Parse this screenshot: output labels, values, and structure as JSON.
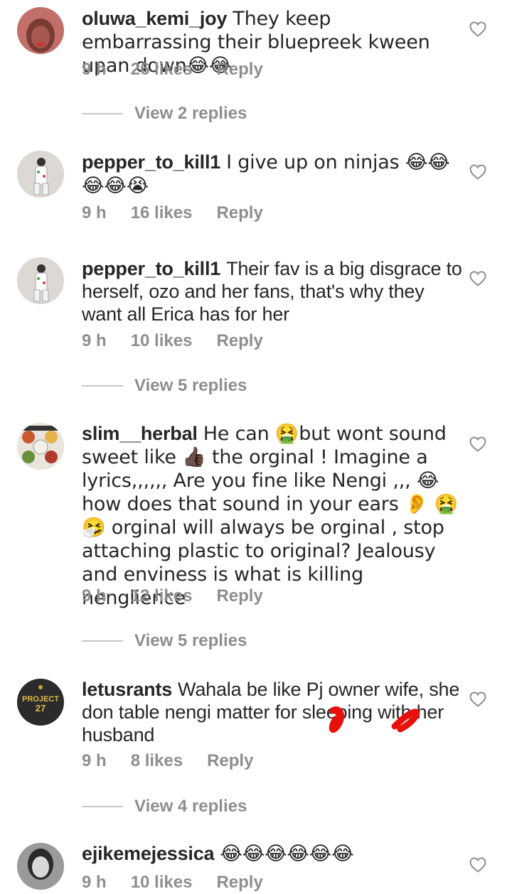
{
  "comments": [
    {
      "username": "oluwa_kemi_joy",
      "text": "They keep embarrassing their bluepreek kween upan down😂😂",
      "time": "9 h",
      "likes": "26 likes",
      "reply_label": "Reply",
      "view_replies": "View 2 replies",
      "avatar_color": "#b05a55"
    },
    {
      "username": "pepper_to_kill1",
      "text": "I give up on ninjas 😂😂😂😂😭",
      "time": "9 h",
      "likes": "16 likes",
      "reply_label": "Reply",
      "avatar_color": "#d8d4d0"
    },
    {
      "username": "pepper_to_kill1",
      "text": "Their fav is a big disgrace to herself, ozo and her fans, that's why they want all Erica has for her",
      "time": "9 h",
      "likes": "10 likes",
      "reply_label": "Reply",
      "view_replies": "View 5 replies",
      "avatar_color": "#d8d4d0"
    },
    {
      "username": "slim__herbal",
      "text": "He can 🤮but wont sound sweet like 👍🏿 the orginal ! Imagine a lyrics,,,,,, Are you fine like Nengi ,,, 😂 how does that sound in your ears 👂 🤮 🤧 orginal will always be orginal , stop attaching plastic to original? Jealousy and enviness is what is killing nenglience",
      "time": "9 h",
      "likes": "12 likes",
      "reply_label": "Reply",
      "view_replies": "View 5 replies",
      "avatar_color": "#9a7b5a"
    },
    {
      "username": "letusrants",
      "text": "Wahala be like Pj owner wife, she don table nengi matter for sleeping with her husband",
      "time": "9 h",
      "likes": "8 likes",
      "reply_label": "Reply",
      "view_replies": "View 4 replies",
      "avatar_color": "#2b2b2b",
      "avatar_text": "PROJECT 27"
    },
    {
      "username": "ejikemejessica",
      "text": "😂😂😂😂😂😂",
      "time": "9 h",
      "likes": "10 likes",
      "reply_label": "Reply",
      "avatar_color": "#7a7a7a"
    }
  ],
  "colors": {
    "text": "#262626",
    "meta": "#8e8e8e",
    "divider": "#c7c7c7",
    "scribble": "#e8100a"
  }
}
